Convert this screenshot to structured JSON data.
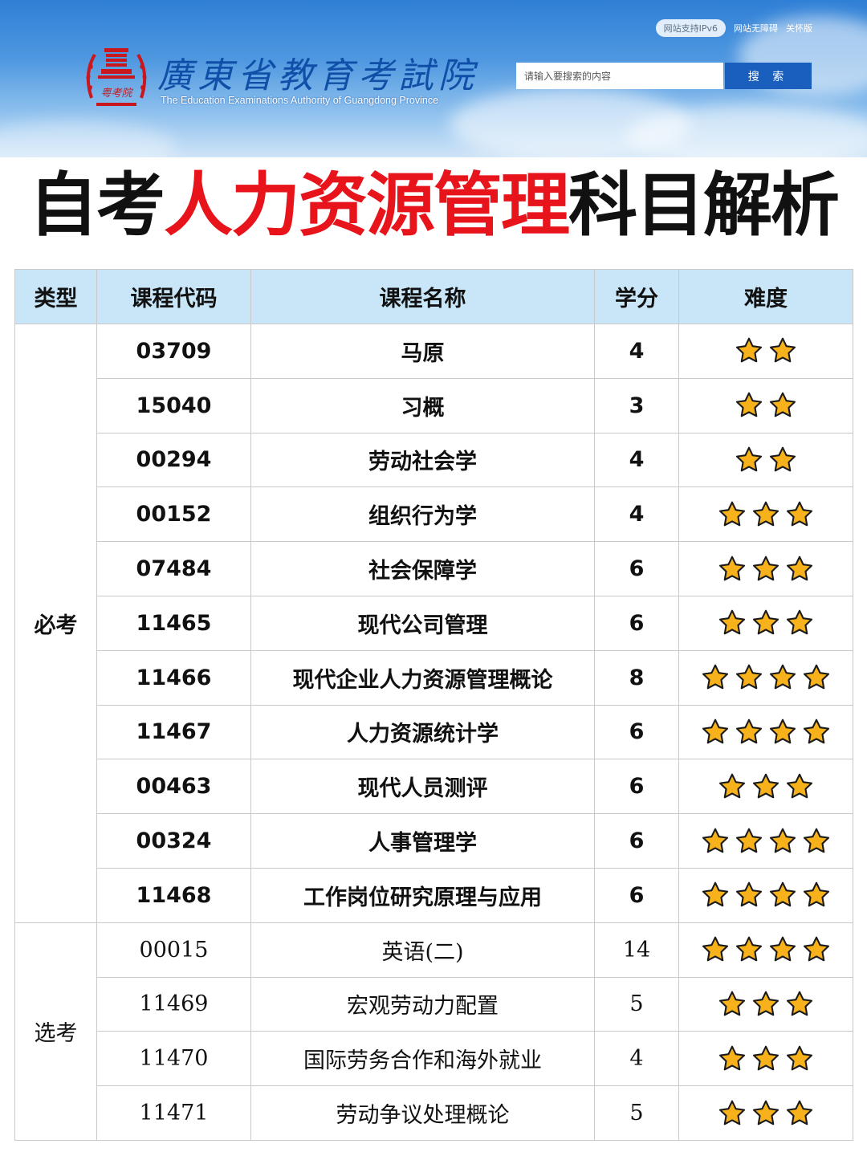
{
  "header": {
    "site_title": "廣東省教育考試院",
    "site_subtitle": "The Education Examinations Authority of Guangdong Province",
    "emblem_text": "粤考院",
    "links": {
      "ipv6": "网站支持IPv6",
      "accessible": "网站无障碍",
      "care": "关怀版"
    },
    "search": {
      "placeholder": "请输入要搜索的内容",
      "button_label": "搜 索"
    }
  },
  "headline": {
    "part1": "自考",
    "part2": "人力资源管理",
    "part3": "科目解析"
  },
  "colors": {
    "accent_red": "#e8141c",
    "header_blue": "#1a5fbd",
    "table_head": "#c9e6f8",
    "star_gold": "#f7b21b"
  },
  "table": {
    "headers": [
      "类型",
      "课程代码",
      "课程名称",
      "学分",
      "难度"
    ],
    "groups": [
      {
        "type": "必考",
        "rows": [
          {
            "code": "03709",
            "name": "马原",
            "credits": "4",
            "stars": 2
          },
          {
            "code": "15040",
            "name": "习概",
            "credits": "3",
            "stars": 2
          },
          {
            "code": "00294",
            "name": "劳动社会学",
            "credits": "4",
            "stars": 2
          },
          {
            "code": "00152",
            "name": "组织行为学",
            "credits": "4",
            "stars": 3
          },
          {
            "code": "07484",
            "name": "社会保障学",
            "credits": "6",
            "stars": 3
          },
          {
            "code": "11465",
            "name": "现代公司管理",
            "credits": "6",
            "stars": 3
          },
          {
            "code": "11466",
            "name": "现代企业人力资源管理概论",
            "credits": "8",
            "stars": 4
          },
          {
            "code": "11467",
            "name": "人力资源统计学",
            "credits": "6",
            "stars": 4
          },
          {
            "code": "00463",
            "name": "现代人员测评",
            "credits": "6",
            "stars": 3
          },
          {
            "code": "00324",
            "name": "人事管理学",
            "credits": "6",
            "stars": 4
          },
          {
            "code": "11468",
            "name": "工作岗位研究原理与应用",
            "credits": "6",
            "stars": 4
          }
        ]
      },
      {
        "type": "选考",
        "rows": [
          {
            "code": "00015",
            "name": "英语(二)",
            "credits": "14",
            "stars": 4
          },
          {
            "code": "11469",
            "name": "宏观劳动力配置",
            "credits": "5",
            "stars": 3
          },
          {
            "code": "11470",
            "name": "国际劳务合作和海外就业",
            "credits": "4",
            "stars": 3
          },
          {
            "code": "11471",
            "name": "劳动争议处理概论",
            "credits": "5",
            "stars": 3
          }
        ]
      }
    ]
  }
}
